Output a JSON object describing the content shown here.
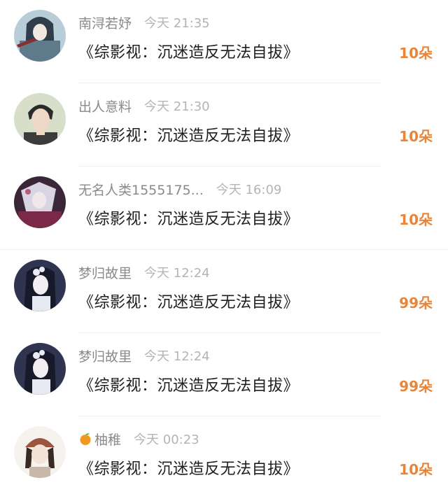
{
  "records": [
    {
      "username": "南浔若妤",
      "time": "今天 21:35",
      "book_title": "《综影视：沉迷造反无法自拔》",
      "gift_count": "10朵",
      "has_emoji_icon": false,
      "avatar_palette": [
        "#9fb8c8",
        "#3b4a57",
        "#d7e3ea"
      ]
    },
    {
      "username": "出人意料",
      "time": "今天 21:30",
      "book_title": "《综影视：沉迷造反无法自拔》",
      "gift_count": "10朵",
      "has_emoji_icon": false,
      "avatar_palette": [
        "#cfd8c4",
        "#2b2b2b",
        "#e9d9c9"
      ]
    },
    {
      "username": "无名人类1555175...",
      "time": "今天 16:09",
      "book_title": "《综影视：沉迷造反无法自拔》",
      "gift_count": "10朵",
      "has_emoji_icon": false,
      "avatar_palette": [
        "#4a2f4a",
        "#c9c3d9",
        "#8a3b5c"
      ]
    },
    {
      "username": "梦归故里",
      "time": "今天 12:24",
      "book_title": "《综影视：沉迷造反无法自拔》",
      "gift_count": "99朵",
      "has_emoji_icon": false,
      "avatar_palette": [
        "#2c3047",
        "#e8e8f0",
        "#5a6284"
      ]
    },
    {
      "username": "梦归故里",
      "time": "今天 12:24",
      "book_title": "《综影视：沉迷造反无法自拔》",
      "gift_count": "99朵",
      "has_emoji_icon": false,
      "avatar_palette": [
        "#2c3047",
        "#e8e8f0",
        "#5a6284"
      ]
    },
    {
      "username": "柚稚",
      "time": "今天 00:23",
      "book_title": "《综影视：沉迷造反无法自拔》",
      "gift_count": "10朵",
      "has_emoji_icon": true,
      "emoji_icon": "orange-icon",
      "avatar_palette": [
        "#f4efe9",
        "#8a4a3a",
        "#3a2a26"
      ]
    }
  ],
  "colors": {
    "username": "#8a8a8a",
    "time": "#b4b4b4",
    "title": "#1f1f1f",
    "count_accent": "#e8853a",
    "divider": "#f0f0f0"
  }
}
